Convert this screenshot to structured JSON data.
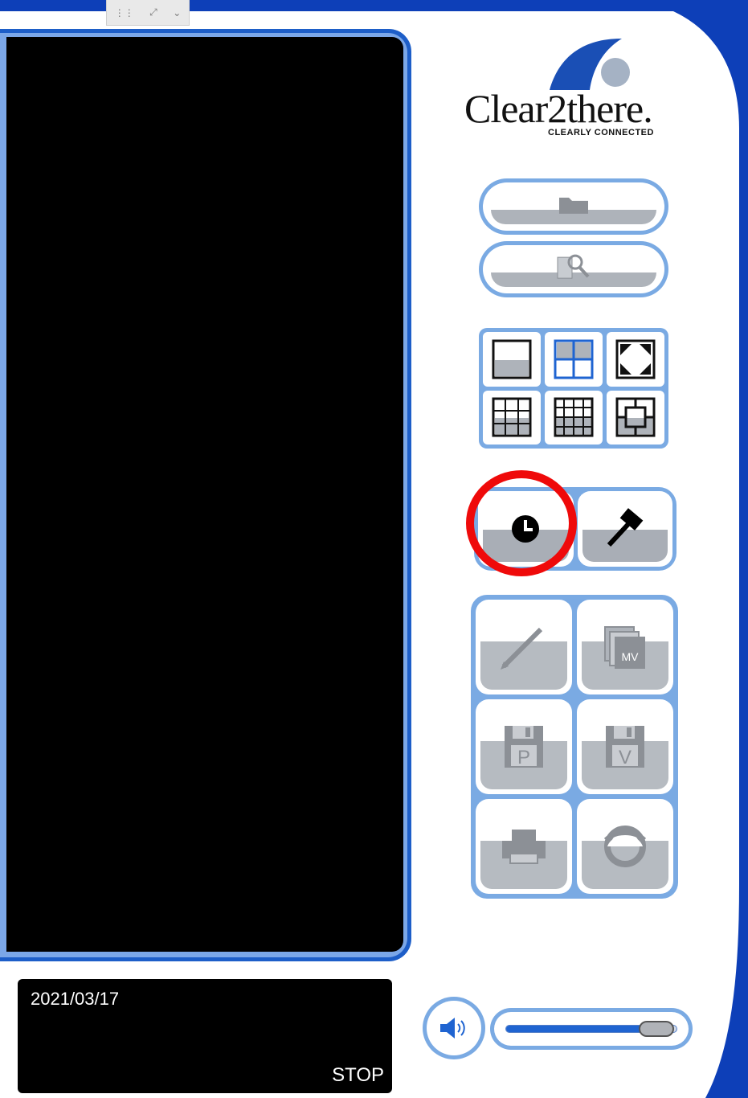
{
  "app": {
    "logo_text": "Clear2there.",
    "logo_tagline": "CLEARLY CONNECTED"
  },
  "toolbar_top": {
    "items": [
      "grid-view-icon",
      "expand-icon",
      "chevron-down-icon"
    ]
  },
  "side_buttons": {
    "open_folder": "folder-icon",
    "search": "search-document-icon"
  },
  "layout_grid": {
    "selected_index": 1,
    "items": [
      "single-view-icon",
      "quad-view-icon",
      "fullscreen-icon",
      "nine-view-icon",
      "sixteen-view-icon",
      "sequence-view-icon"
    ]
  },
  "actions": {
    "schedule": "clock-icon",
    "tools": "hammer-icon"
  },
  "tools": {
    "items": [
      "pen-icon",
      "mv-icon",
      "save-p-icon",
      "save-v-icon",
      "printer-icon",
      "eye-icon"
    ],
    "mv_label": "MV",
    "p_label": "P",
    "v_label": "V"
  },
  "status": {
    "date": "2021/03/17",
    "state": "STOP"
  },
  "volume": {
    "level": 0.88
  },
  "colors": {
    "accent_blue": "#1f64d1",
    "frame_blue": "#7aaae3",
    "highlight_red": "#ef0a0a"
  }
}
